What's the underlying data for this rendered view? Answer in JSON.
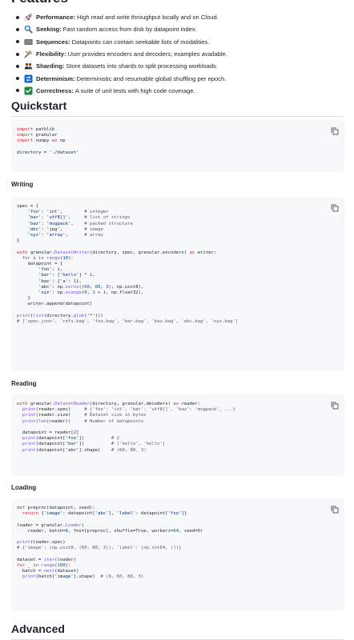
{
  "features_heading": "Features",
  "features": [
    {
      "icon": "rocket-icon",
      "title": "Performance:",
      "text": "High read and write throughput locally and on Cloud."
    },
    {
      "icon": "magnifier-icon",
      "title": "Seeking:",
      "text": "Fast random access from disk by datapoint index."
    },
    {
      "icon": "film-frames-icon",
      "title": "Sequences:",
      "text": "Datapoints can contain seekable lists of modalities."
    },
    {
      "icon": "wrench-icon",
      "title": "Flexibility:",
      "text": "User provides encoders and decoders; examples available."
    },
    {
      "icon": "people-icon",
      "title": "Sharding:",
      "text": "Store datasets into shards to split processing workloads."
    },
    {
      "icon": "repeat-icon",
      "title": "Determinism:",
      "text": "Deterministic and resumable global shuffling per epoch."
    },
    {
      "icon": "check-mark-icon",
      "title": "Correctness:",
      "text": "A suite of unit tests with high code coverage."
    }
  ],
  "sections": {
    "quickstart": "Quickstart",
    "writing": "Writing",
    "reading": "Reading",
    "loading": "Loading",
    "advanced": "Advanced"
  },
  "code": {
    "quickstart": [
      "import pathlib",
      "import granular",
      "import numpy as np",
      "",
      "directory = './dataset'"
    ],
    "writing": [
      "spec = {",
      "    'foo': 'int',        # integer",
      "    'bar': 'utf8[]',     # list of strings",
      "    'baz': 'msgpack',    # packed structure",
      "    'abc': 'jpg',        # image",
      "    'xyz': 'array',      # array",
      "}",
      "",
      "with granular.DatasetWriter(directory, spec, granular.encoders) as writer:",
      "  for i in range(10):",
      "    datapoint = {",
      "        'foo': i,",
      "        'bar': ['hello'] * i,",
      "        'baz': {'a': 1},",
      "        'abc': np.zeros((60, 80, 3), np.uint8),",
      "        'xyz': np.arange(0, 1 + i, np.float32),",
      "    }",
      "    writer.append(datapoint)",
      "",
      "print(list(directory.glob('*')))",
      "# ['spec.json', 'refs.bag', 'foo.bag', 'bar.bag', 'baz.bag', 'abc.bag', 'xyz.bag']"
    ],
    "reading": [
      "with granular.DatasetReader(directory, granular.decoders) as reader:",
      "  print(reader.spec)     # {'foo': 'int', 'bar': 'utf8[]', 'baz': 'msgpack', ...}",
      "  print(reader.size)     # Dataset size in bytes",
      "  print(len(reader))     # Number of datapoints",
      "",
      "  datapoint = reader[2]",
      "  print(datapoint['foo'])          # 2",
      "  print(datapoint['bar'])          # ['hello', 'hello']",
      "  print(datapoint['abc'].shape)    # (60, 80, 3)"
    ],
    "loading": [
      "def preproc(datapoint, seed):",
      "  return {'image': datapoint['abc'], 'label': datapoint['foo']}",
      "",
      "loader = granular.Loader(",
      "    reader, batch=8, fns=[preproc], shuffle=True, workers=64, seed=0)",
      "",
      "print(loader.spec)",
      "# {'image': (np.uint8, (60, 80, 3)), 'label': (np.int64, ())}",
      "",
      "dataset = iter(loader)",
      "for _ in range(100):",
      "  batch = next(dataset)",
      "  print(batch['image'].shape)  # (8, 60, 80, 3)"
    ]
  }
}
